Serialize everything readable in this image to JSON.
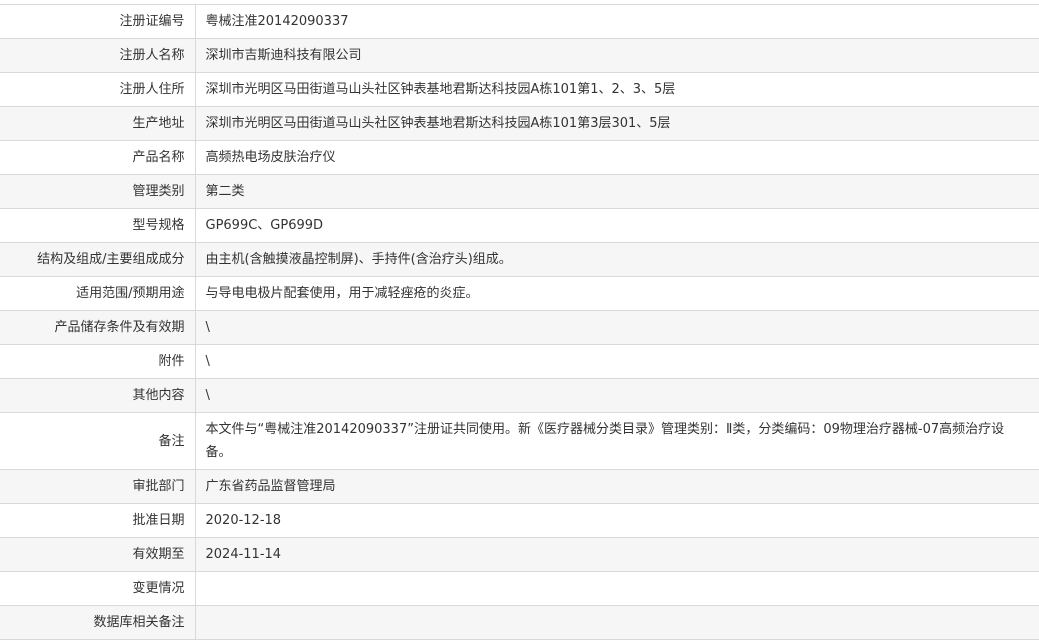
{
  "rows": [
    {
      "label": "注册证编号",
      "value": "粤械注准20142090337"
    },
    {
      "label": "注册人名称",
      "value": "深圳市吉斯迪科技有限公司"
    },
    {
      "label": "注册人住所",
      "value": "深圳市光明区马田街道马山头社区钟表基地君斯达科技园A栋101第1、2、3、5层"
    },
    {
      "label": "生产地址",
      "value": "深圳市光明区马田街道马山头社区钟表基地君斯达科技园A栋101第3层301、5层"
    },
    {
      "label": "产品名称",
      "value": "高频热电场皮肤治疗仪"
    },
    {
      "label": "管理类别",
      "value": "第二类"
    },
    {
      "label": "型号规格",
      "value": "GP699C、GP699D"
    },
    {
      "label": "结构及组成/主要组成成分",
      "value": "由主机(含触摸液晶控制屏)、手持件(含治疗头)组成。"
    },
    {
      "label": "适用范围/预期用途",
      "value": "与导电电极片配套使用，用于减轻痤疮的炎症。"
    },
    {
      "label": "产品储存条件及有效期",
      "value": "\\"
    },
    {
      "label": "附件",
      "value": "\\"
    },
    {
      "label": "其他内容",
      "value": "\\"
    },
    {
      "label": "备注",
      "value": "本文件与“粤械注准20142090337”注册证共同使用。新《医疗器械分类目录》管理类别：Ⅱ类，分类编码：09物理治疗器械-07高频治疗设备。"
    },
    {
      "label": "审批部门",
      "value": "广东省药品监督管理局"
    },
    {
      "label": "批准日期",
      "value": "2020-12-18"
    },
    {
      "label": "有效期至",
      "value": "2024-11-14"
    },
    {
      "label": "变更情况",
      "value": ""
    },
    {
      "label": "数据库相关备注",
      "value": ""
    }
  ]
}
